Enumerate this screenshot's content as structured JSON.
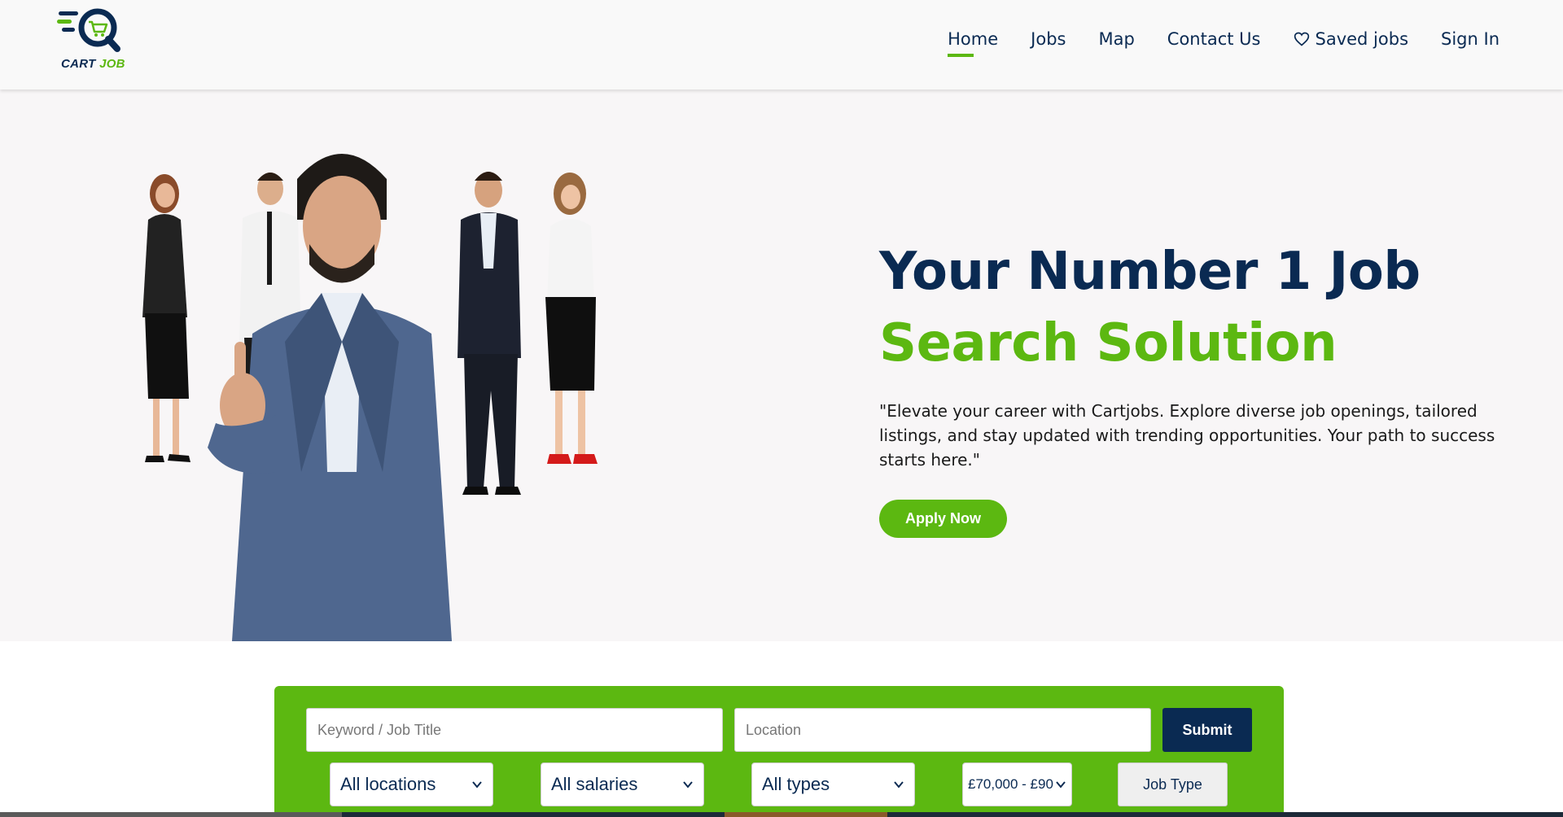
{
  "brand": {
    "logo_text_part1": "CART",
    "logo_text_part2": "JOB",
    "colors": {
      "navy": "#0a2a52",
      "green": "#5cb811"
    }
  },
  "nav": {
    "items": [
      {
        "label": "Home",
        "active": true
      },
      {
        "label": "Jobs",
        "active": false
      },
      {
        "label": "Map",
        "active": false
      },
      {
        "label": "Contact Us",
        "active": false
      },
      {
        "label": "Saved jobs",
        "active": false,
        "icon": "heart-icon"
      },
      {
        "label": "Sign In",
        "active": false
      }
    ]
  },
  "hero": {
    "title_line1": "Your Number 1 Job",
    "title_line2": "Search Solution",
    "description": "\"Elevate your career with Cartjobs. Explore diverse job openings, tailored listings, and stay updated with trending opportunities. Your path to success starts here.\"",
    "apply_label": "Apply Now"
  },
  "search": {
    "keyword_placeholder": "Keyword / Job Title",
    "location_placeholder": "Location",
    "submit_label": "Submit",
    "location_select": "All locations",
    "salary_select": "All salaries",
    "type_select": "All types",
    "salary_range_select": "£70,000 - £90",
    "job_type_label": "Job Type"
  }
}
